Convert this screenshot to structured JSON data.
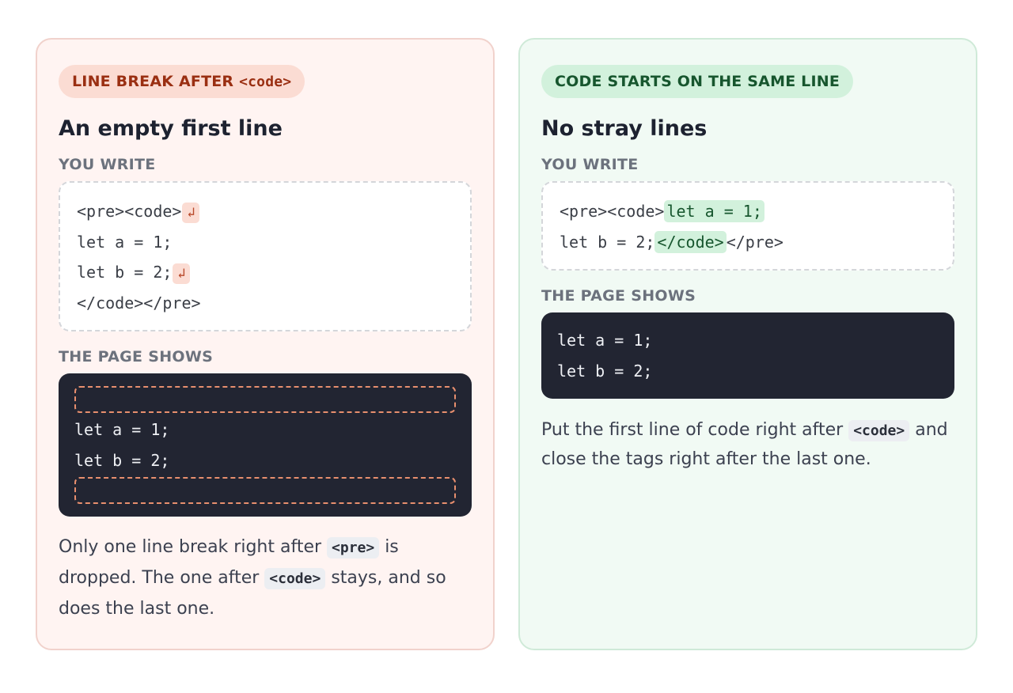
{
  "left_card": {
    "badge_text": "LINE BREAK AFTER ",
    "badge_code": "<code>",
    "title": "An empty first line",
    "write_label": "YOU WRITE",
    "write_lines": [
      "<pre><code>",
      "let a = 1;",
      "let b = 2;",
      "</code></pre>"
    ],
    "return_glyph": "↲",
    "shows_label": "THE PAGE SHOWS",
    "shows_lines": [
      "let a = 1;",
      "let b = 2;"
    ],
    "note_part1": "Only one line break right after ",
    "note_code1": "<pre>",
    "note_part2": " is dropped. The one after ",
    "note_code2": "<code>",
    "note_part3": " stays, and so does the last one."
  },
  "right_card": {
    "badge_text": "CODE STARTS ON THE SAME LINE",
    "title": "No stray lines",
    "write_label": "YOU WRITE",
    "write_line1_prefix": "<pre><code>",
    "write_line1_highlight": "let a = 1;",
    "write_line2_prefix": "let b = 2;",
    "write_line2_highlight": "</code>",
    "write_line2_suffix": "</pre>",
    "shows_label": "THE PAGE SHOWS",
    "shows_lines": [
      "let a = 1;",
      "let b = 2;"
    ],
    "note_part1": "Put the first line of code right after ",
    "note_code1": "<code>",
    "note_part2": " and close the tags right after the last one."
  },
  "colors": {
    "bad_bg": "#fff4f2",
    "bad_accent": "#9a2f12",
    "good_bg": "#f1faf4",
    "good_accent": "#17562e",
    "code_dark": "#222532"
  }
}
